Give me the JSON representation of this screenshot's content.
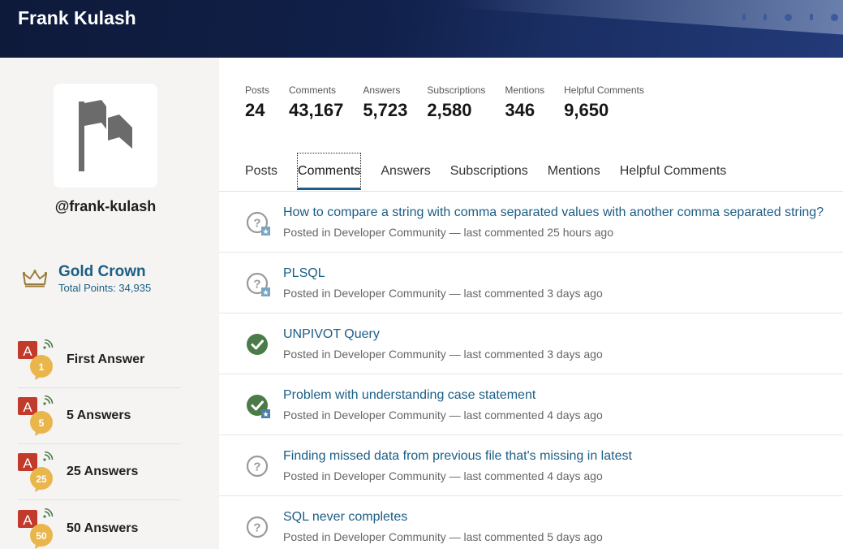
{
  "header": {
    "title": "Frank Kulash"
  },
  "profile": {
    "handle": "@frank-kulash",
    "rank": {
      "name": "Gold Crown",
      "points_text": "Total Points: 34,935"
    },
    "badges": [
      {
        "label": "First Answer",
        "count": "1"
      },
      {
        "label": "5 Answers",
        "count": "5"
      },
      {
        "label": "25 Answers",
        "count": "25"
      },
      {
        "label": "50 Answers",
        "count": "50"
      }
    ]
  },
  "stats": [
    {
      "label": "Posts",
      "value": "24"
    },
    {
      "label": "Comments",
      "value": "43,167"
    },
    {
      "label": "Answers",
      "value": "5,723"
    },
    {
      "label": "Subscriptions",
      "value": "2,580"
    },
    {
      "label": "Mentions",
      "value": "346"
    },
    {
      "label": "Helpful Comments",
      "value": "9,650"
    }
  ],
  "tabs": [
    {
      "label": "Posts"
    },
    {
      "label": "Comments",
      "active": true
    },
    {
      "label": "Answers"
    },
    {
      "label": "Subscriptions"
    },
    {
      "label": "Mentions"
    },
    {
      "label": "Helpful Comments"
    }
  ],
  "items": [
    {
      "title": "How to compare a string with comma separated values with another comma separated string?",
      "meta": "Posted in Developer Community — last commented 25 hours ago",
      "icon": "question-icon",
      "starred": true
    },
    {
      "title": "PLSQL",
      "meta": "Posted in Developer Community — last commented 3 days ago",
      "icon": "question-icon",
      "starred": true
    },
    {
      "title": "UNPIVOT Query",
      "meta": "Posted in Developer Community — last commented 3 days ago",
      "icon": "answered-check-icon",
      "starred": false
    },
    {
      "title": "Problem with understanding case statement",
      "meta": "Posted in Developer Community — last commented 4 days ago",
      "icon": "answered-check-icon",
      "starred": true
    },
    {
      "title": "Finding missed data from previous file that's missing in latest",
      "meta": "Posted in Developer Community — last commented 4 days ago",
      "icon": "question-icon",
      "starred": false
    },
    {
      "title": "SQL never completes",
      "meta": "Posted in Developer Community — last commented 5 days ago",
      "icon": "question-icon",
      "starred": false
    }
  ],
  "colors": {
    "link": "#1b5e86",
    "check_green": "#4a7b48",
    "badge_red": "#c23a2b",
    "badge_gold": "#e9b64b",
    "banner_dark": "#0e1a3a"
  }
}
